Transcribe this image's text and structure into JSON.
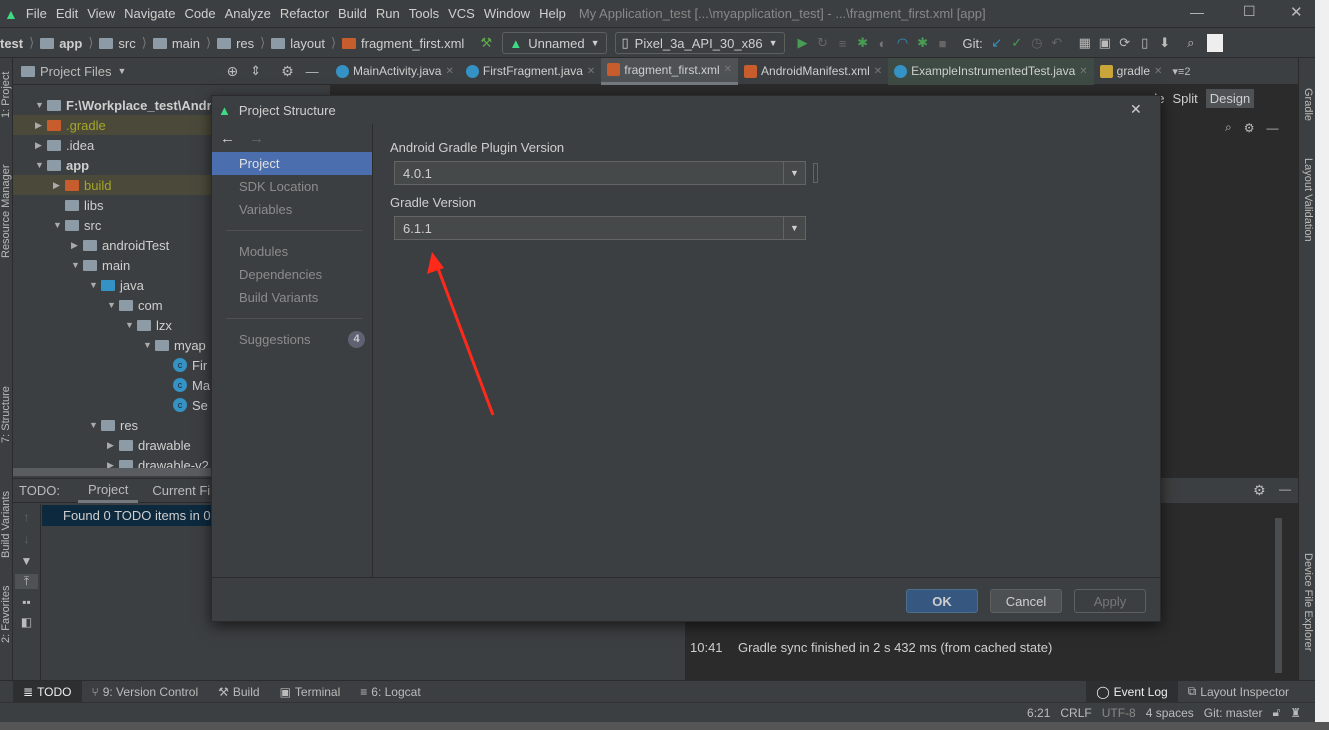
{
  "title_bar": {
    "menu": [
      "File",
      "Edit",
      "View",
      "Navigate",
      "Code",
      "Analyze",
      "Refactor",
      "Build",
      "Run",
      "Tools",
      "VCS",
      "Window",
      "Help"
    ],
    "window_title": "My Application_test [...\\myapplication_test] - ...\\fragment_first.xml [app]"
  },
  "nav_bar": {
    "breadcrumbs": [
      "test",
      "app",
      "src",
      "main",
      "res",
      "layout",
      "fragment_first.xml"
    ],
    "run_config": "Unnamed",
    "device": "Pixel_3a_API_30_x86",
    "git_label": "Git:"
  },
  "project_panel": {
    "view": "Project Files",
    "tree": [
      {
        "label": "F:\\Workplace_test\\AndroidStudio_Workplace\\",
        "level": 0,
        "type": "module",
        "expanded": true,
        "bold": true
      },
      {
        "label": ".gradle",
        "level": 0,
        "type": "folder-orange",
        "expanded": false,
        "color": "#a5a52a"
      },
      {
        "label": ".idea",
        "level": 0,
        "type": "folder",
        "expanded": false
      },
      {
        "label": "app",
        "level": 0,
        "type": "module",
        "expanded": true,
        "bold": true
      },
      {
        "label": "build",
        "level": 1,
        "type": "folder-orange",
        "expanded": false,
        "color": "#a5a52a"
      },
      {
        "label": "libs",
        "level": 1,
        "type": "folder",
        "leaf": true
      },
      {
        "label": "src",
        "level": 1,
        "type": "folder",
        "expanded": true
      },
      {
        "label": "androidTest",
        "level": 2,
        "type": "folder",
        "expanded": false
      },
      {
        "label": "main",
        "level": 2,
        "type": "folder",
        "expanded": true
      },
      {
        "label": "java",
        "level": 3,
        "type": "folder-blue",
        "expanded": true
      },
      {
        "label": "com",
        "level": 4,
        "type": "package",
        "expanded": true
      },
      {
        "label": "lzx",
        "level": 5,
        "type": "package",
        "expanded": true
      },
      {
        "label": "myap",
        "level": 6,
        "type": "package",
        "expanded": true
      },
      {
        "label": "Fir",
        "level": 7,
        "type": "class",
        "leaf": true
      },
      {
        "label": "Ma",
        "level": 7,
        "type": "class",
        "leaf": true
      },
      {
        "label": "Se",
        "level": 7,
        "type": "class",
        "leaf": true
      },
      {
        "label": "res",
        "level": 3,
        "type": "folder",
        "expanded": true
      },
      {
        "label": "drawable",
        "level": 4,
        "type": "folder",
        "expanded": false
      },
      {
        "label": "drawable-v2",
        "level": 4,
        "type": "folder",
        "expanded": false
      }
    ]
  },
  "todo_panel": {
    "label": "TODO:",
    "tabs": [
      "Project",
      "Current File"
    ],
    "active_tab": "Project",
    "message": "Found 0 TODO items in 0"
  },
  "editor_tabs": [
    {
      "label": "MainActivity.java"
    },
    {
      "label": "FirstFragment.java"
    },
    {
      "label": "fragment_first.xml",
      "active": true
    },
    {
      "label": "AndroidManifest.xml"
    },
    {
      "label": "ExampleInstrumentedTest.java"
    },
    {
      "label": "gradle"
    }
  ],
  "editor_modes": {
    "code": "de",
    "split": "Split",
    "design": "Design"
  },
  "left_strip": [
    "1: Project",
    "Resource Manager",
    "7: Structure",
    "Build Variants",
    "2: Favorites"
  ],
  "right_strip": [
    "Gradle",
    "Layout Validation",
    "Device File Explorer"
  ],
  "dialog": {
    "title": "Project Structure",
    "sidebar": [
      "Project",
      "SDK Location",
      "Variables",
      "Modules",
      "Dependencies",
      "Build Variants",
      "Suggestions"
    ],
    "selected": "Project",
    "suggestions_count": "4",
    "plugin_label": "Android Gradle Plugin Version",
    "plugin_value": "4.0.1",
    "gradle_label": "Gradle Version",
    "gradle_value": "6.1.1",
    "ok": "OK",
    "cancel": "Cancel",
    "apply": "Apply"
  },
  "event_log": {
    "time": "10:41",
    "message": "Gradle sync finished in 2 s 432 ms (from cached state)"
  },
  "bottom_bar": {
    "left": [
      "TODO",
      "9: Version Control",
      "Build",
      "Terminal",
      "6: Logcat"
    ],
    "right": [
      "Event Log",
      "Layout Inspector"
    ]
  },
  "status_bar": {
    "position": "6:21",
    "line_sep": "CRLF",
    "encoding": "UTF-8",
    "indent": "4 spaces",
    "git": "Git: master"
  },
  "colors": {
    "accent": "#4b6eaf",
    "annotation_arrow": "#ff2a1a",
    "android_green": "#3ddc84"
  }
}
